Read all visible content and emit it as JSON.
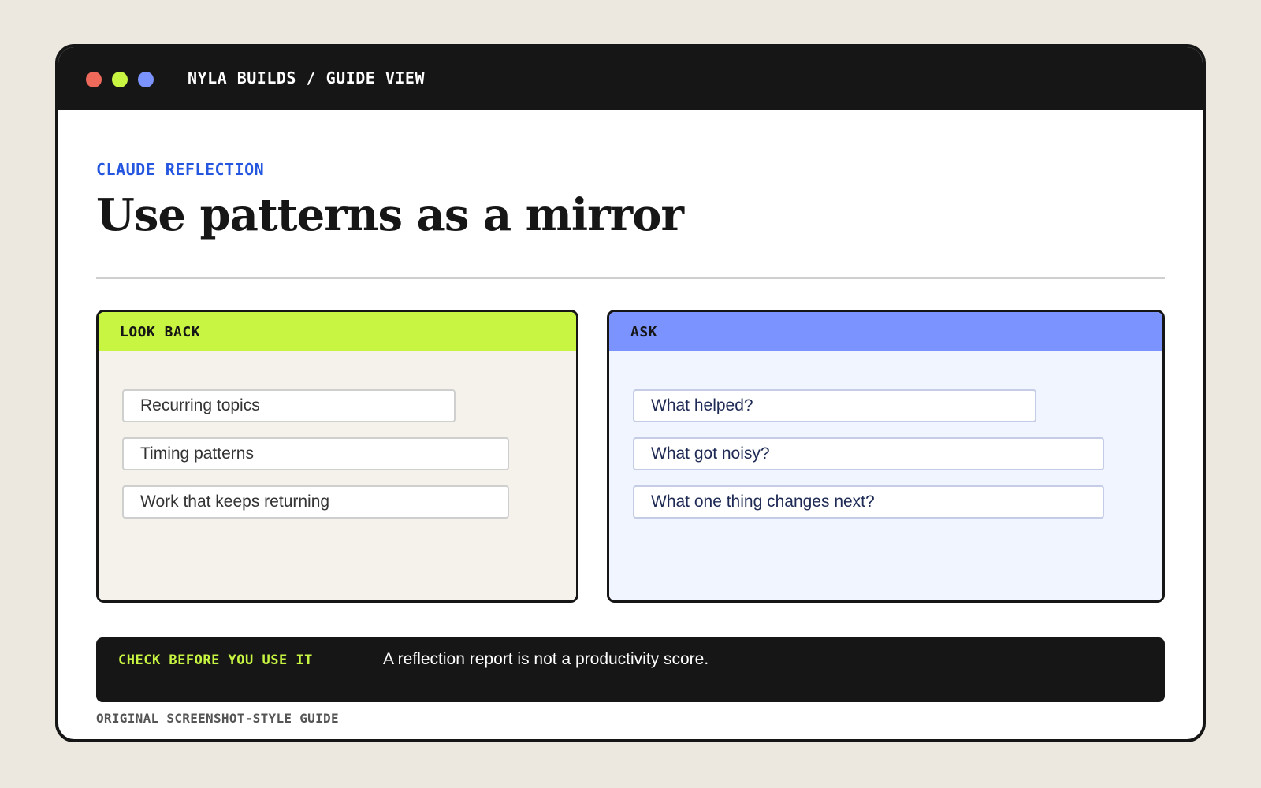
{
  "window": {
    "title": "NYLA BUILDS / GUIDE VIEW",
    "controls": [
      "close",
      "minimize",
      "zoom"
    ]
  },
  "colors": {
    "background": "#ece8e0",
    "chrome": "#161616",
    "accent_lime": "#c8f542",
    "accent_periwinkle": "#7b93ff",
    "accent_blue_text": "#2456e0",
    "dot_red": "#ed6a5a"
  },
  "main": {
    "eyebrow": "CLAUDE REFLECTION",
    "title": "Use patterns as a mirror"
  },
  "panels": {
    "look_back": {
      "header": "LOOK BACK",
      "items": [
        "Recurring topics",
        "Timing patterns",
        "Work that keeps returning"
      ]
    },
    "ask": {
      "header": "ASK",
      "items": [
        "What helped?",
        "What got noisy?",
        "What one thing changes next?"
      ]
    }
  },
  "callout": {
    "label": "CHECK BEFORE YOU USE IT",
    "text": "A reflection report is not a productivity score."
  },
  "footer": {
    "note": "ORIGINAL SCREENSHOT-STYLE GUIDE"
  }
}
